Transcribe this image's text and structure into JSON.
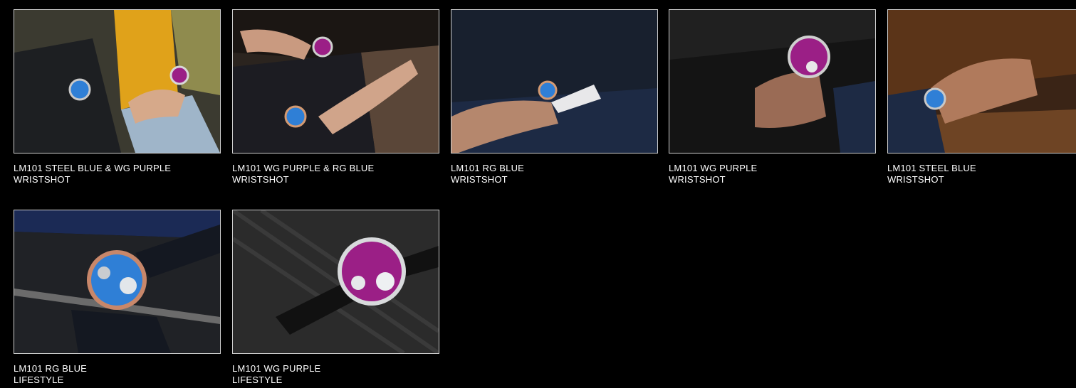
{
  "gallery": {
    "items": [
      {
        "title": "LM101 STEEL BLUE & WG PURPLE",
        "subtitle": "WRISTSHOT"
      },
      {
        "title": "LM101 WG PURPLE & RG BLUE",
        "subtitle": "WRISTSHOT"
      },
      {
        "title": "LM101 RG BLUE",
        "subtitle": "WRISTSHOT"
      },
      {
        "title": "LM101 WG PURPLE",
        "subtitle": "WRISTSHOT"
      },
      {
        "title": "LM101 STEEL BLUE",
        "subtitle": "WRISTSHOT"
      },
      {
        "title": "LM101 RG BLUE",
        "subtitle": "LIFESTYLE"
      },
      {
        "title": "LM101 WG PURPLE",
        "subtitle": "LIFESTYLE"
      }
    ]
  },
  "colors": {
    "background": "#000000",
    "text": "#ffffff",
    "thumb_border": "#cfcfcf",
    "dial_blue": "#2f7fd6",
    "dial_purple": "#9b1f86"
  }
}
